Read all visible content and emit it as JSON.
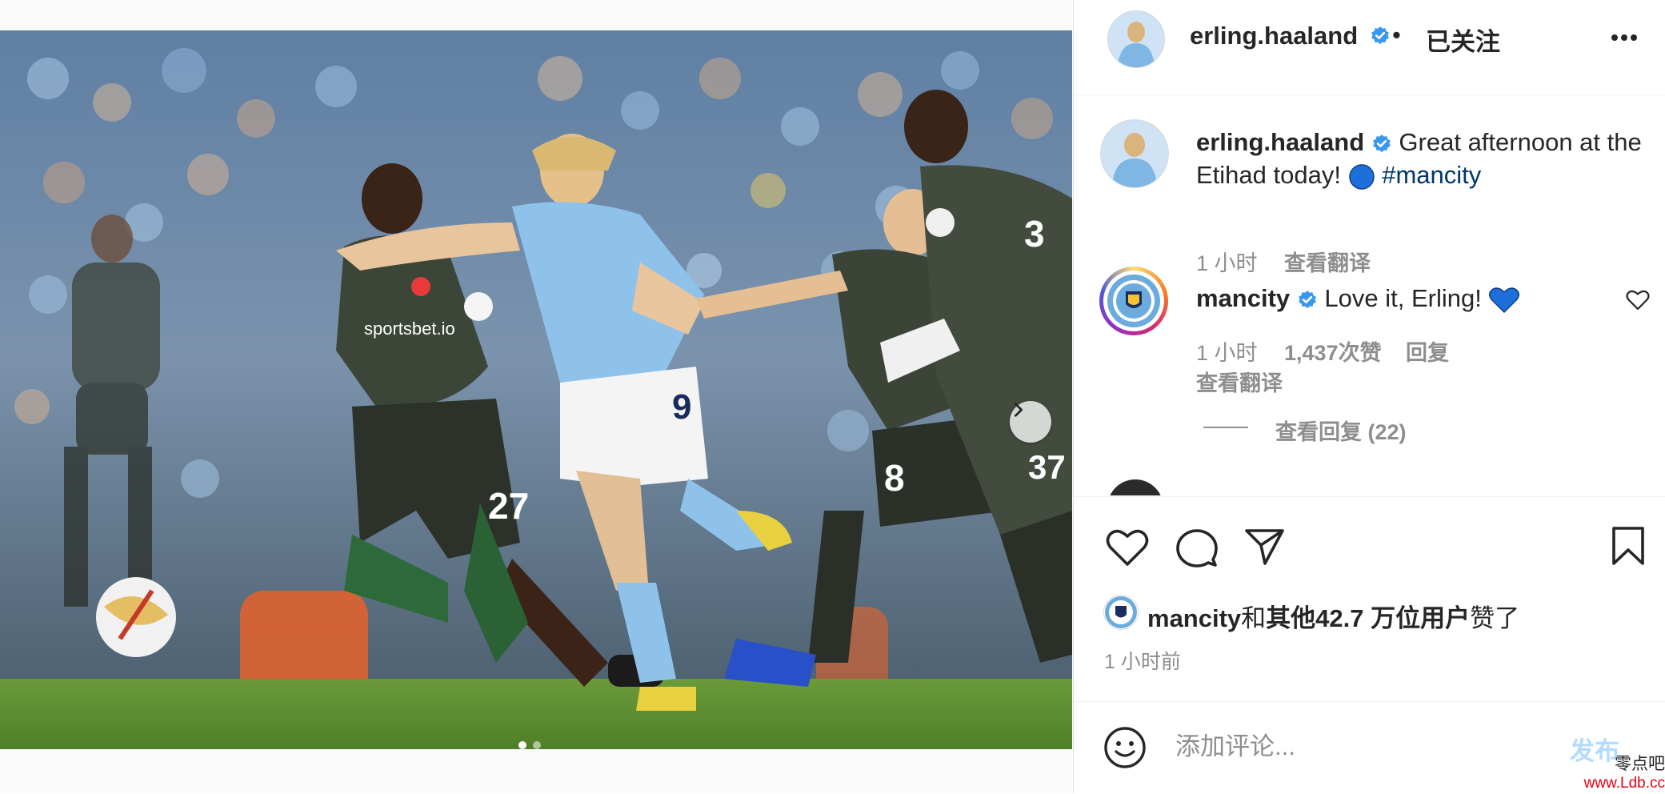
{
  "colors": {
    "verified": "#3897f0",
    "link_blue": "#00376b",
    "muted": "#8e8e8e",
    "post_disabled": "#b3dbff"
  },
  "post": {
    "author": "erling.haaland",
    "follow_status": "已关注",
    "separator": "•",
    "carousel": {
      "current": 1,
      "total": 2
    }
  },
  "caption": {
    "username": "erling.haaland",
    "text": "Great afternoon at the Etihad today!",
    "emoji": "blue-circle",
    "hashtag": "#mancity",
    "time": "1 小时",
    "translate": "查看翻译"
  },
  "comments": [
    {
      "username": "mancity",
      "text": "Love it, Erling!",
      "emoji": "blue-heart",
      "time": "1 小时",
      "likes": "1,437次赞",
      "reply": "回复",
      "translate": "查看翻译",
      "view_replies": "查看回复 (22)"
    }
  ],
  "actions": {
    "like": "heart-icon",
    "comment": "comment-icon",
    "share": "share-icon",
    "save": "bookmark-icon"
  },
  "likes": {
    "prefix_user": "mancity",
    "joiner": "和",
    "others": "其他42.7 万位用户",
    "suffix": "赞了"
  },
  "post_time": "1 小时前",
  "comment_input": {
    "placeholder": "添加评论...",
    "post_label": "发布"
  },
  "watermark": {
    "line1": "零点吧",
    "line2": "www.Ldb.cc"
  }
}
